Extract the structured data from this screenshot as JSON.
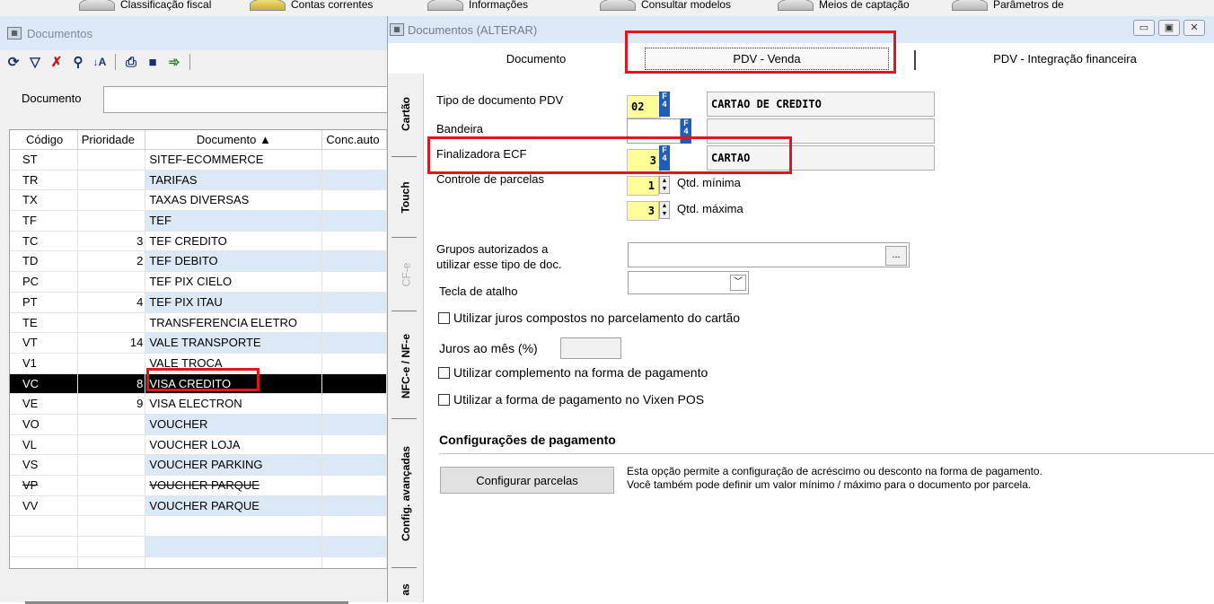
{
  "topbar": {
    "items": [
      {
        "label": "Classificação fiscal"
      },
      {
        "label": "Contas correntes"
      },
      {
        "label": "Informações"
      },
      {
        "label": "Consultar modelos"
      },
      {
        "label": "Meios de captação"
      },
      {
        "label": "Parâmetros de"
      }
    ]
  },
  "left": {
    "title": "Documentos",
    "filter_label": "Documento",
    "columns": {
      "code": "Código",
      "priority": "Prioridade",
      "document": "Documento ▲",
      "conc": "Conc.auto"
    },
    "rows": [
      {
        "code": "ST",
        "priority": "",
        "document": "SITEF-ECOMMERCE"
      },
      {
        "code": "TR",
        "priority": "",
        "document": "TARIFAS"
      },
      {
        "code": "TX",
        "priority": "",
        "document": "TAXAS DIVERSAS"
      },
      {
        "code": "TF",
        "priority": "",
        "document": "TEF"
      },
      {
        "code": "TC",
        "priority": "3",
        "document": "TEF CREDITO"
      },
      {
        "code": "TD",
        "priority": "2",
        "document": "TEF DEBITO"
      },
      {
        "code": "PC",
        "priority": "",
        "document": "TEF PIX CIELO"
      },
      {
        "code": "PT",
        "priority": "4",
        "document": "TEF PIX ITAU"
      },
      {
        "code": "TE",
        "priority": "",
        "document": "TRANSFERENCIA ELETRO"
      },
      {
        "code": "VT",
        "priority": "14",
        "document": "VALE TRANSPORTE"
      },
      {
        "code": "V1",
        "priority": "",
        "document": "VALE TROCA"
      },
      {
        "code": "VC",
        "priority": "8",
        "document": "VISA CREDITO"
      },
      {
        "code": "VE",
        "priority": "9",
        "document": "VISA ELECTRON"
      },
      {
        "code": "VO",
        "priority": "",
        "document": "VOUCHER"
      },
      {
        "code": "VL",
        "priority": "",
        "document": "VOUCHER LOJA"
      },
      {
        "code": "VS",
        "priority": "",
        "document": "VOUCHER PARKING"
      },
      {
        "code": "VP",
        "priority": "",
        "document": "VOUCHER PARQUE"
      },
      {
        "code": "VV",
        "priority": "",
        "document": "VOUCHER PARQUE"
      }
    ],
    "selected_code": "VC"
  },
  "right": {
    "title": "Documentos (ALTERAR)",
    "tabs_top": [
      "Documento",
      "PDV - Venda",
      "PDV - Integração financeira"
    ],
    "active_tab": "PDV - Venda",
    "vtabs": [
      "Cartão",
      "Touch",
      "CF-e",
      "NFC-e / NF-e",
      "Config. avançadas",
      "as"
    ],
    "form": {
      "tipo_label": "Tipo de documento PDV",
      "tipo_code": "02",
      "tipo_desc": "CARTAO DE CREDITO",
      "bandeira_label": "Bandeira",
      "finalizadora_label": "Finalizadora ECF",
      "finalizadora_code": "3",
      "finalizadora_desc": "CARTAO",
      "parcelas_label": "Controle de parcelas",
      "qtd_min": "1",
      "qtd_min_label": "Qtd. mínima",
      "qtd_max": "3",
      "qtd_max_label": "Qtd. máxima",
      "grupos_label_1": "Grupos autorizados a",
      "grupos_label_2": "utilizar esse tipo de doc.",
      "grupos_btn": "...",
      "tecla_label": "Tecla de atalho",
      "chk_juros": "Utilizar juros compostos no parcelamento do cartão",
      "juros_label": "Juros ao mês (%)",
      "chk_complemento": "Utilizar complemento na forma de pagamento",
      "chk_vixen": "Utilizar a forma de pagamento no Vixen POS",
      "config_title": "Configurações de pagamento",
      "config_btn": "Configurar parcelas",
      "note_1": "Esta opção permite a configuração de acréscimo ou desconto na forma de pagamento.",
      "note_2": "Você também pode definir um valor mínimo / máximo para o documento por parcela.",
      "f4_key": "F4"
    }
  },
  "colors": {
    "highlight": "#e0161e",
    "input_yellow": "#ffff99",
    "row_alt": "#dbe9f7",
    "f4_blue": "#1f5db8"
  }
}
